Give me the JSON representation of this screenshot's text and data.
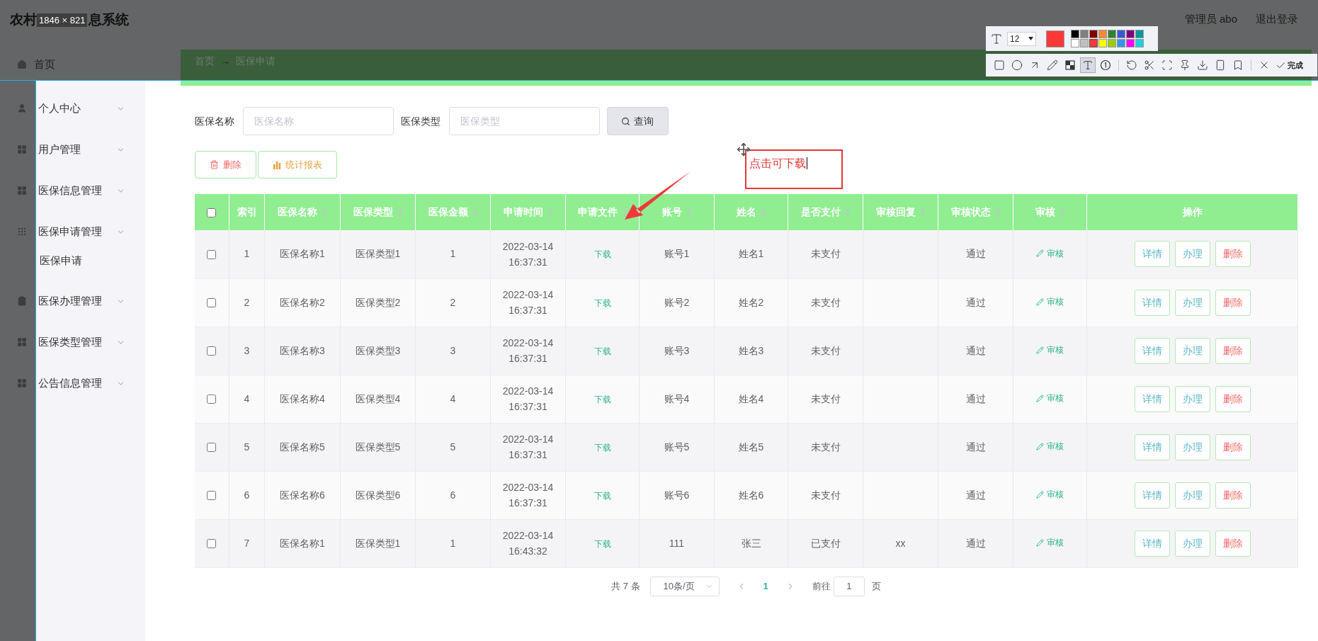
{
  "header": {
    "title_parts": [
      "农村",
      "息系统"
    ],
    "capture_size": "1846 × 821",
    "user": "管理员 abo",
    "logout": "退出登录"
  },
  "breadcrumb": [
    "首页",
    "→",
    "医保申请"
  ],
  "sidebar": {
    "items": [
      {
        "label": "首页",
        "kind": "home",
        "expandable": false
      },
      {
        "label": "个人中心",
        "kind": "user",
        "expandable": true
      },
      {
        "label": "用户管理",
        "kind": "grid",
        "expandable": true
      },
      {
        "label": "医保信息管理",
        "kind": "grid",
        "expandable": true
      },
      {
        "label": "医保申请管理",
        "kind": "apps",
        "expandable": true,
        "children": [
          {
            "label": "医保申请"
          }
        ]
      },
      {
        "label": "医保办理管理",
        "kind": "clipboard",
        "expandable": true
      },
      {
        "label": "医保类型管理",
        "kind": "grid",
        "expandable": true
      },
      {
        "label": "公告信息管理",
        "kind": "grid",
        "expandable": true
      }
    ]
  },
  "search": {
    "fields": [
      {
        "label": "医保名称",
        "placeholder": "医保名称"
      },
      {
        "label": "医保类型",
        "placeholder": "医保类型"
      }
    ],
    "button": "查询"
  },
  "actions": [
    {
      "label": "删除",
      "kind": "delete"
    },
    {
      "label": "统计报表",
      "kind": "report"
    }
  ],
  "table": {
    "header_checkbox": {
      "checked": false
    },
    "columns": [
      {
        "label": "索引",
        "sortable": false
      },
      {
        "label": "医保名称",
        "sortable": true
      },
      {
        "label": "医保类型",
        "sortable": true
      },
      {
        "label": "医保金额",
        "sortable": true
      },
      {
        "label": "申请时间",
        "sortable": true
      },
      {
        "label": "申请文件",
        "sortable": true
      },
      {
        "label": "账号",
        "sortable": true
      },
      {
        "label": "姓名",
        "sortable": true
      },
      {
        "label": "是否支付",
        "sortable": true
      },
      {
        "label": "审核回复",
        "sortable": true
      },
      {
        "label": "审核状态",
        "sortable": true
      },
      {
        "label": "审核",
        "sortable": true
      },
      {
        "label": "操作",
        "sortable": false
      }
    ],
    "rows": [
      {
        "checked": false,
        "index": "1",
        "name": "医保名称1",
        "type": "医保类型1",
        "amount": "1",
        "time": "2022-03-14 16:37:31",
        "file": "下载",
        "account": "账号1",
        "person": "姓名1",
        "paid": "未支付",
        "status": "通过",
        "review": "审核",
        "buttons": [
          {
            "label": "详情",
            "kind": "info"
          },
          {
            "label": "办理",
            "kind": "info"
          },
          {
            "label": "删除",
            "kind": "danger"
          }
        ]
      },
      {
        "checked": false,
        "index": "2",
        "name": "医保名称2",
        "type": "医保类型2",
        "amount": "2",
        "time": "2022-03-14 16:37:31",
        "file": "下载",
        "account": "账号2",
        "person": "姓名2",
        "paid": "未支付",
        "status": "通过",
        "review": "审核",
        "buttons": [
          {
            "label": "详情",
            "kind": "info"
          },
          {
            "label": "办理",
            "kind": "info"
          },
          {
            "label": "删除",
            "kind": "danger"
          }
        ]
      },
      {
        "checked": false,
        "index": "3",
        "name": "医保名称3",
        "type": "医保类型3",
        "amount": "3",
        "time": "2022-03-14 16:37:31",
        "file": "下载",
        "account": "账号3",
        "person": "姓名3",
        "paid": "未支付",
        "status": "通过",
        "review": "审核",
        "buttons": [
          {
            "label": "详情",
            "kind": "info"
          },
          {
            "label": "办理",
            "kind": "info"
          },
          {
            "label": "删除",
            "kind": "danger"
          }
        ]
      },
      {
        "checked": false,
        "index": "4",
        "name": "医保名称4",
        "type": "医保类型4",
        "amount": "4",
        "time": "2022-03-14 16:37:31",
        "file": "下载",
        "account": "账号4",
        "person": "姓名4",
        "paid": "未支付",
        "status": "通过",
        "review": "审核",
        "buttons": [
          {
            "label": "详情",
            "kind": "info"
          },
          {
            "label": "办理",
            "kind": "info"
          },
          {
            "label": "删除",
            "kind": "danger"
          }
        ]
      },
      {
        "checked": false,
        "index": "5",
        "name": "医保名称5",
        "type": "医保类型5",
        "amount": "5",
        "time": "2022-03-14 16:37:31",
        "file": "下载",
        "account": "账号5",
        "person": "姓名5",
        "paid": "未支付",
        "status": "通过",
        "review": "审核",
        "buttons": [
          {
            "label": "详情",
            "kind": "info"
          },
          {
            "label": "办理",
            "kind": "info"
          },
          {
            "label": "删除",
            "kind": "danger"
          }
        ]
      },
      {
        "checked": false,
        "index": "6",
        "name": "医保名称6",
        "type": "医保类型6",
        "amount": "6",
        "time": "2022-03-14 16:37:31",
        "file": "下载",
        "account": "账号6",
        "person": "姓名6",
        "paid": "未支付",
        "status": "通过",
        "review": "审核",
        "buttons": [
          {
            "label": "详情",
            "kind": "info"
          },
          {
            "label": "办理",
            "kind": "info"
          },
          {
            "label": "删除",
            "kind": "danger"
          }
        ]
      },
      {
        "checked": false,
        "index": "7",
        "name": "医保名称1",
        "type": "医保类型1",
        "amount": "1",
        "time": "2022-03-14 16:43:32",
        "file": "下载",
        "account": "111",
        "person": "张三",
        "paid": "已支付",
        "reply": "xx",
        "status": "通过",
        "review": "审核",
        "buttons": [
          {
            "label": "详情",
            "kind": "info"
          },
          {
            "label": "办理",
            "kind": "info"
          },
          {
            "label": "删除",
            "kind": "danger"
          }
        ]
      }
    ]
  },
  "pagination": {
    "total": "共 7 条",
    "page_size": "10条/页",
    "pages": [
      {
        "label": "1",
        "selected": true
      }
    ],
    "goto": "前往",
    "goto_value": "1",
    "unit": "页"
  },
  "annotation": {
    "text": "点击可下载"
  },
  "capture_toolbar": {
    "font_size": "12",
    "palette": [
      {
        "color": "#000000",
        "selected": false
      },
      {
        "color": "#808080",
        "selected": false
      },
      {
        "color": "#800000",
        "selected": false
      },
      {
        "color": "#f7883a",
        "selected": false
      },
      {
        "color": "#308430",
        "selected": false
      },
      {
        "color": "#385ad3",
        "selected": false
      },
      {
        "color": "#800080",
        "selected": false
      },
      {
        "color": "#009999",
        "selected": false
      },
      {
        "color": "#ffffff",
        "selected": false
      },
      {
        "color": "#c0c0c0",
        "selected": false
      },
      {
        "color": "#fb3838",
        "selected": true
      },
      {
        "color": "#ffff00",
        "selected": false
      },
      {
        "color": "#99cc00",
        "selected": false
      },
      {
        "color": "#3895e6",
        "selected": false
      },
      {
        "color": "#ff00ff",
        "selected": false
      },
      {
        "color": "#1ad3de",
        "selected": false
      }
    ],
    "tools": [
      {
        "kind": "rect",
        "selected": false
      },
      {
        "kind": "ellipse",
        "selected": false
      },
      {
        "kind": "arrow",
        "selected": false
      },
      {
        "kind": "pen",
        "selected": false
      },
      {
        "kind": "mosaic",
        "selected": false
      },
      {
        "kind": "text",
        "selected": true
      },
      {
        "kind": "number",
        "selected": false
      },
      {
        "kind": "sep"
      },
      {
        "kind": "undo",
        "selected": false
      },
      {
        "kind": "cut",
        "selected": false
      },
      {
        "kind": "ocr",
        "selected": false
      },
      {
        "kind": "pin",
        "selected": false
      },
      {
        "kind": "save",
        "selected": false
      },
      {
        "kind": "phone",
        "selected": false
      },
      {
        "kind": "bookmark",
        "selected": false
      },
      {
        "kind": "sep"
      },
      {
        "kind": "close",
        "selected": false
      }
    ],
    "done": "完成"
  }
}
